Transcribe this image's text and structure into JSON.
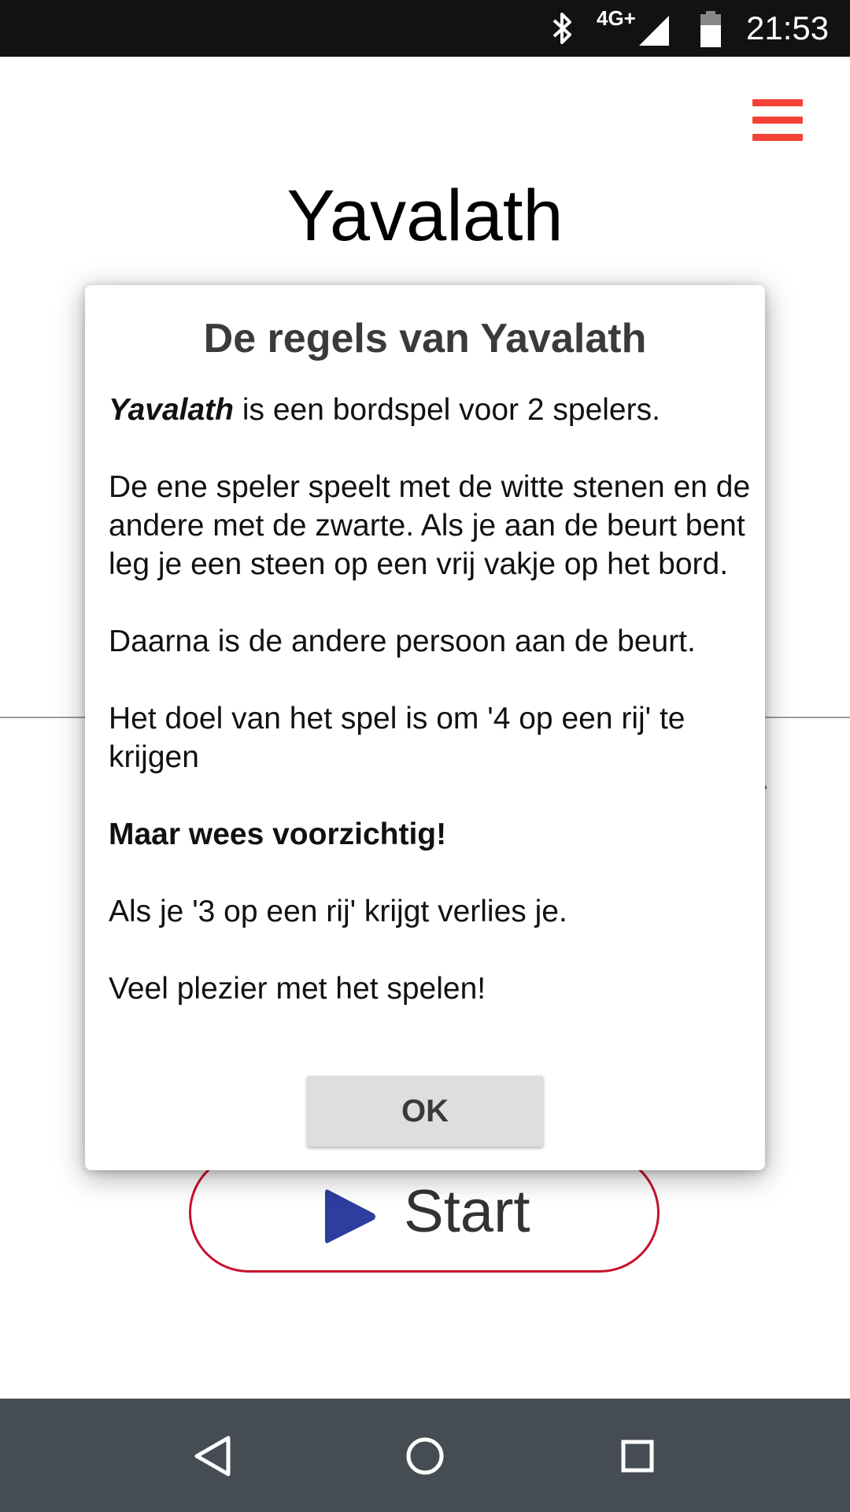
{
  "status_bar": {
    "network": "4G+",
    "time": "21:53",
    "icons": [
      "bluetooth-icon",
      "signal-icon",
      "battery-icon"
    ]
  },
  "app": {
    "title": "Yavalath",
    "menu_icon": "hamburger-menu-icon",
    "start_label": "Start"
  },
  "dialog": {
    "title": "De regels van Yavalath",
    "intro_name": "Yavalath",
    "intro_rest": " is een bordspel voor 2 spelers.",
    "paragraphs": [
      "De ene speler speelt met de witte stenen en de andere met de zwarte. Als je aan de beurt bent leg je een steen op een vrij vakje op het bord.",
      "Daarna is de andere persoon aan de beurt.",
      "Het doel van het spel is om '4 op een rij' te krijgen"
    ],
    "warning": "Maar wees voorzichtig!",
    "closing": [
      "Als je '3 op een rij' krijgt verlies je.",
      "Veel plezier met het spelen!"
    ],
    "ok_label": "OK"
  },
  "nav_bar": {
    "icons": [
      "back-icon",
      "home-icon",
      "recents-icon"
    ]
  },
  "colors": {
    "menu_accent": "#f44336",
    "start_border": "#c8102e",
    "play_icon": "#2e3d9e",
    "nav_bar": "#454c53",
    "status_bar": "#121212"
  }
}
